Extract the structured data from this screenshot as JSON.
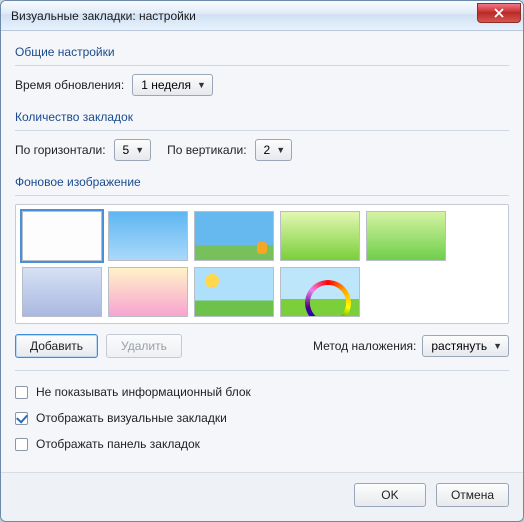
{
  "window": {
    "title": "Визуальные закладки: настройки"
  },
  "general": {
    "heading": "Общие настройки",
    "refresh_label": "Время обновления:",
    "refresh_value": "1 неделя"
  },
  "count": {
    "heading": "Количество закладок",
    "horiz_label": "По горизонтали:",
    "horiz_value": "5",
    "vert_label": "По вертикали:",
    "vert_value": "2"
  },
  "background": {
    "heading": "Фоновое изображение",
    "add_label": "Добавить",
    "delete_label": "Удалить",
    "overlay_label": "Метод наложения:",
    "overlay_value": "растянуть",
    "thumbs": [
      {
        "name": "white",
        "selected": true
      },
      {
        "name": "bluesky",
        "selected": false
      },
      {
        "name": "bluemeadow",
        "selected": false
      },
      {
        "name": "limegreen",
        "selected": false
      },
      {
        "name": "lightgreen",
        "selected": false
      },
      {
        "name": "softblue",
        "selected": false
      },
      {
        "name": "sunrise",
        "selected": false
      },
      {
        "name": "sunnyfield",
        "selected": false
      },
      {
        "name": "rainbow",
        "selected": false
      }
    ]
  },
  "checks": {
    "hide_info": {
      "label": "Не показывать информационный блок",
      "checked": false
    },
    "show_visual": {
      "label": "Отображать визуальные закладки",
      "checked": true
    },
    "show_panel": {
      "label": "Отображать панель закладок",
      "checked": false
    }
  },
  "footer": {
    "ok": "OK",
    "cancel": "Отмена"
  }
}
